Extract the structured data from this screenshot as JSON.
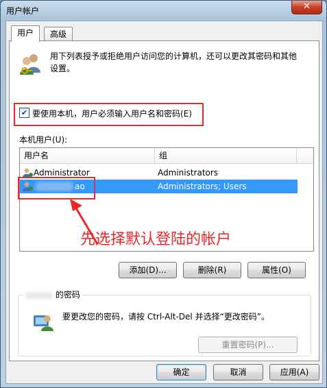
{
  "window": {
    "title": "用户帐户",
    "close_glyph": "✕"
  },
  "tabs": [
    {
      "label": "用户"
    },
    {
      "label": "高级"
    }
  ],
  "intro_text_line1": "用下列表授予或拒绝用户访问您的计算机，还可以更改其密码和其他",
  "intro_text_line2": "设置。",
  "require_login": {
    "label": "要使用本机，用户必须输入用户名和密码(E)",
    "checked": true,
    "check_glyph": "✔"
  },
  "users_list": {
    "label": "本机用户(U):",
    "columns": [
      "用户名",
      "组"
    ],
    "rows": [
      {
        "name": "Administrator",
        "group": "Administrators",
        "selected": false
      },
      {
        "name": "ao",
        "group": "Administrators; Users",
        "selected": true
      }
    ]
  },
  "annotation": {
    "text": "先选择默认登陆的帐户",
    "color": "#e8282b"
  },
  "user_buttons": {
    "add": "添加(D)...",
    "delete": "删除(R)",
    "properties": "属性(O)"
  },
  "password_section": {
    "title": "的密码",
    "text": "要更改您的密码，请按 Ctrl-Alt-Del 并选择“更改密码”。",
    "reset_button": "重置密码(P)..."
  },
  "dialog_buttons": {
    "ok": "确定",
    "cancel": "取消",
    "apply": "应用(A)"
  }
}
